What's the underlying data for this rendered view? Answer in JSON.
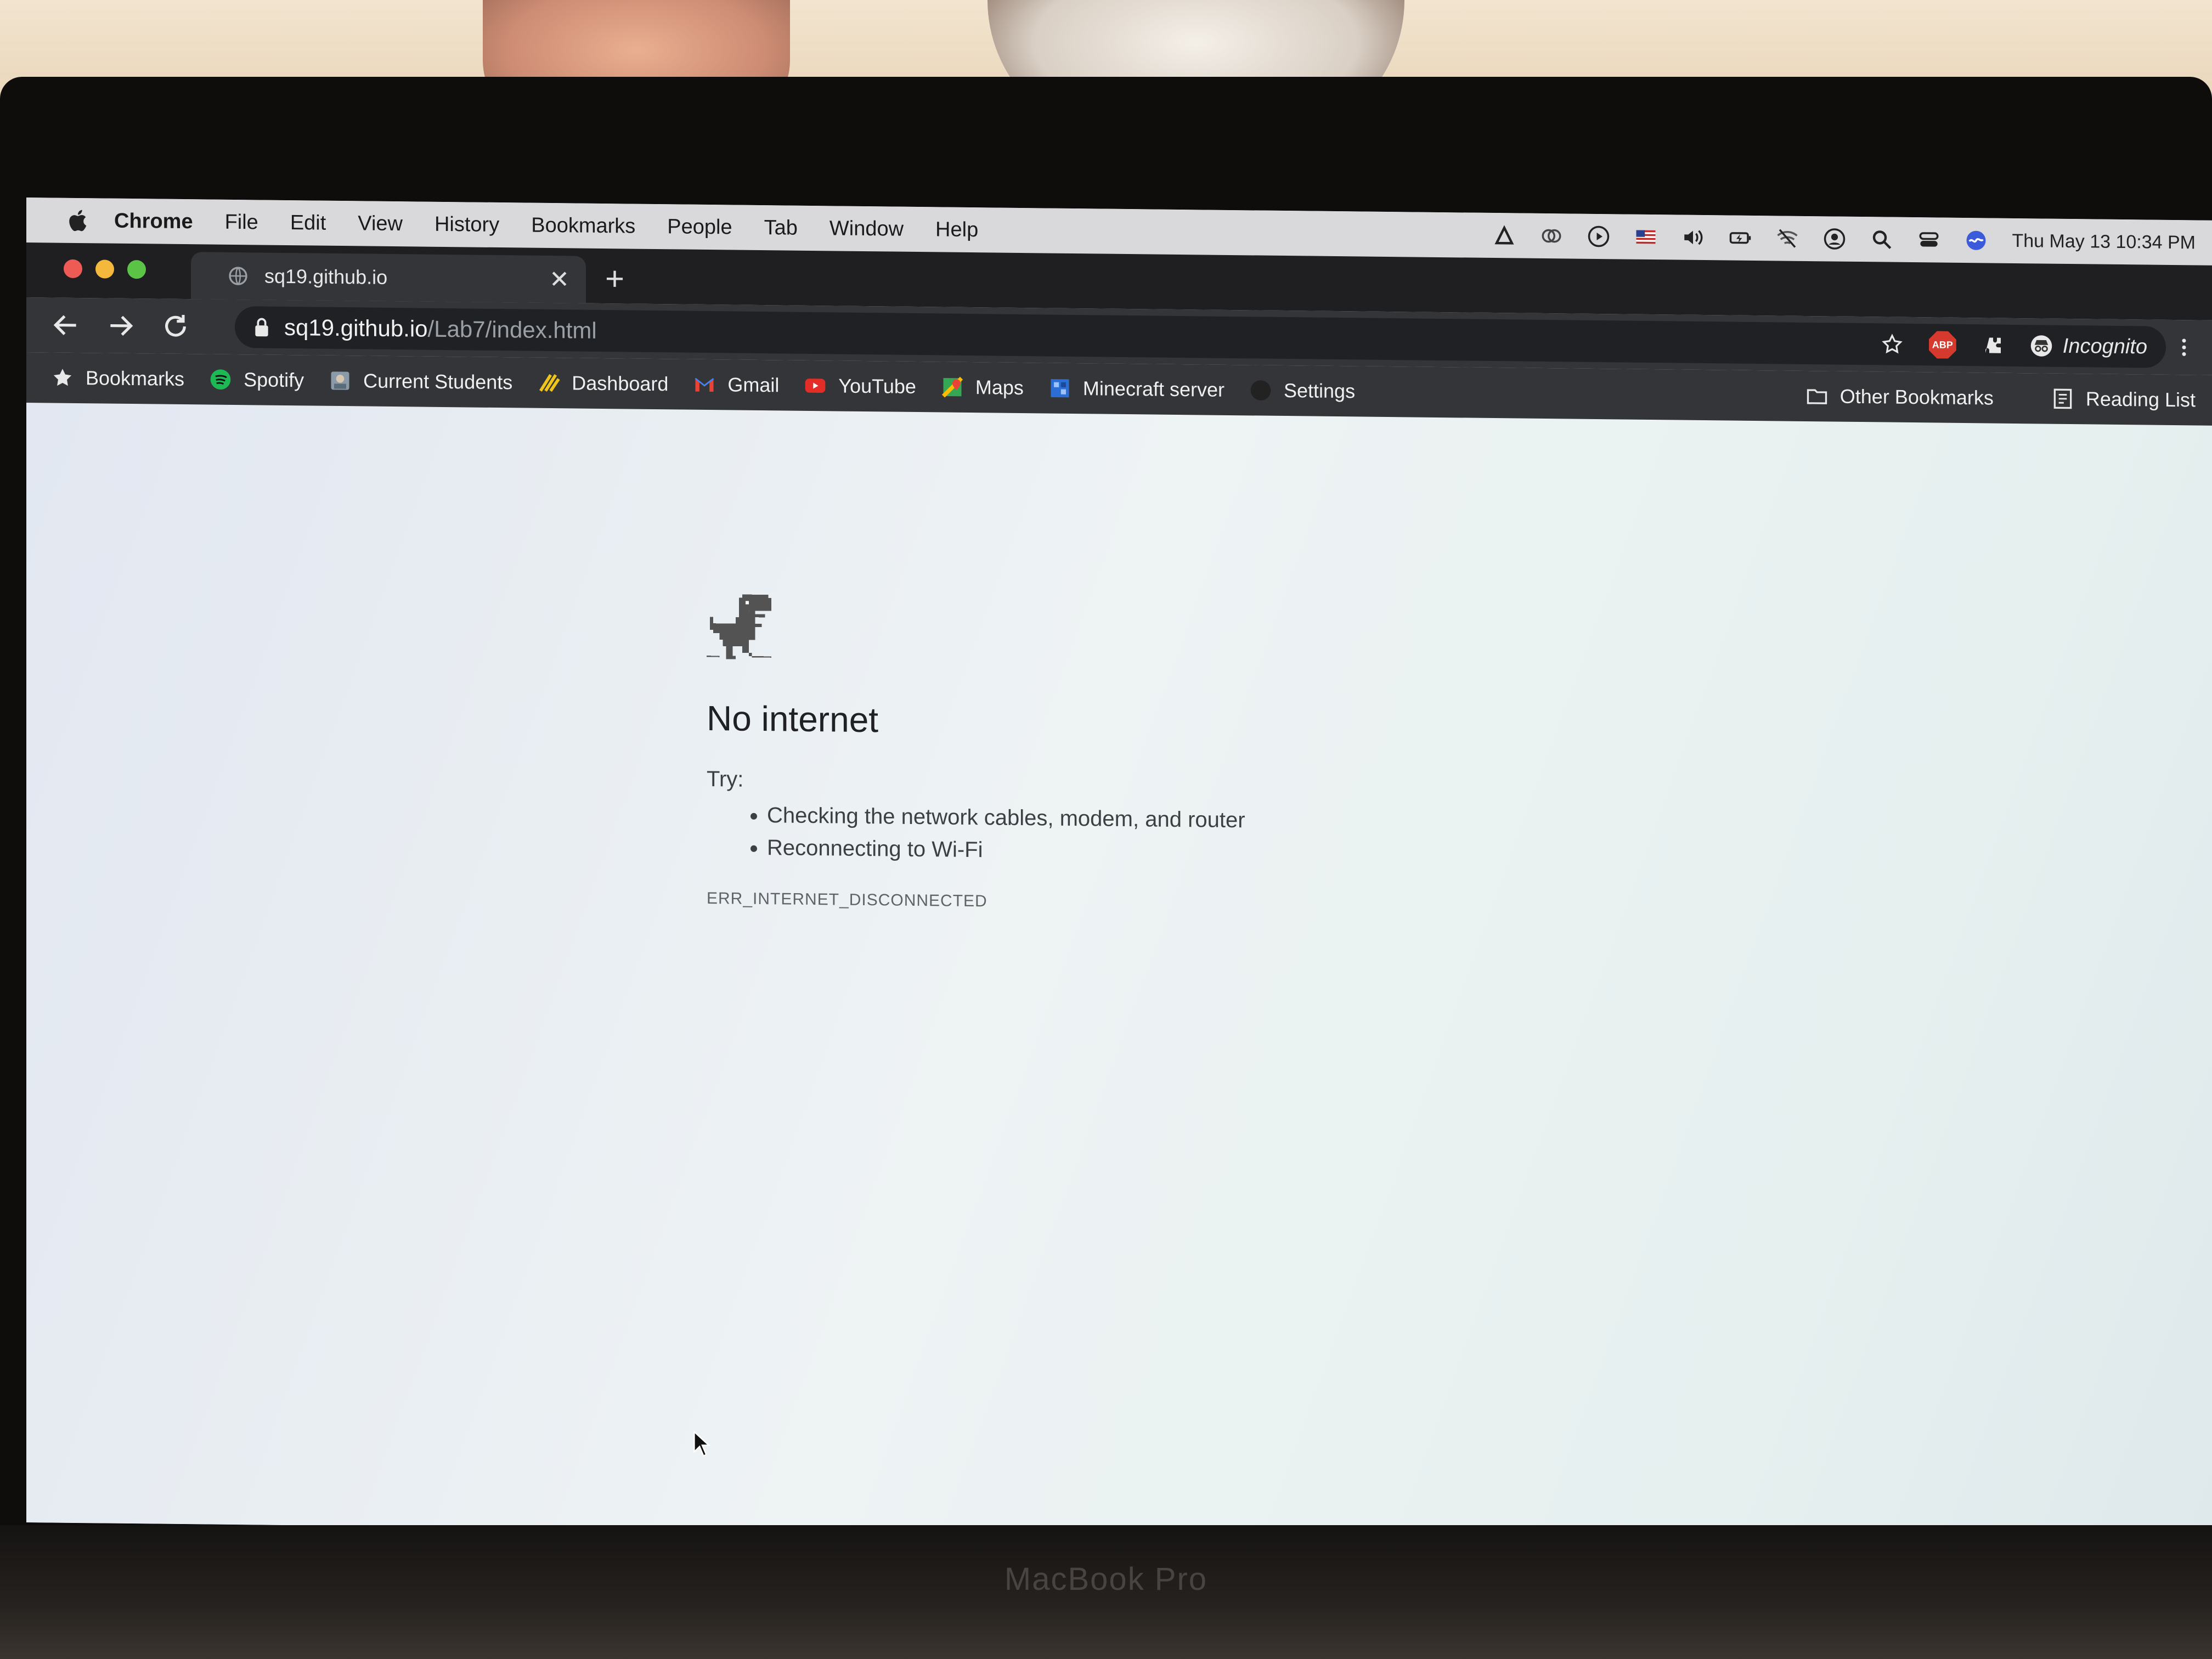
{
  "menubar": {
    "app_name": "Chrome",
    "menus": [
      "File",
      "Edit",
      "View",
      "History",
      "Bookmarks",
      "People",
      "Tab",
      "Window",
      "Help"
    ],
    "clock": "Thu May 13  10:34 PM"
  },
  "tab": {
    "title": "sq19.github.io",
    "close_glyph": "✕",
    "new_tab_glyph": "+"
  },
  "address_bar": {
    "host": "sq19.github.io",
    "path": "/Lab7/index.html"
  },
  "toolbar": {
    "abp_label": "ABP",
    "profile_label": "Incognito"
  },
  "bookmarks": {
    "items": [
      {
        "label": "Bookmarks",
        "icon": "star-icon"
      },
      {
        "label": "Spotify",
        "icon": "spotify-icon"
      },
      {
        "label": "Current Students",
        "icon": "site-icon"
      },
      {
        "label": "Dashboard",
        "icon": "dashboard-icon"
      },
      {
        "label": "Gmail",
        "icon": "gmail-icon"
      },
      {
        "label": "YouTube",
        "icon": "youtube-icon"
      },
      {
        "label": "Maps",
        "icon": "maps-icon"
      },
      {
        "label": "Minecraft server",
        "icon": "minecraft-icon"
      },
      {
        "label": "Settings",
        "icon": "github-icon"
      }
    ],
    "other": "Other Bookmarks",
    "reading_list": "Reading List"
  },
  "error_page": {
    "heading": "No internet",
    "try_label": "Try:",
    "suggestions": [
      "Checking the network cables, modem, and router",
      "Reconnecting to Wi-Fi"
    ],
    "error_code": "ERR_INTERNET_DISCONNECTED"
  },
  "device_label": "MacBook Pro",
  "colors": {
    "close": "#ee5b55",
    "minimize": "#f3b83c",
    "maximize": "#5bc346",
    "chrome_dark": "#333538",
    "youtube_red": "#e52d27",
    "spotify_green": "#1db954"
  }
}
